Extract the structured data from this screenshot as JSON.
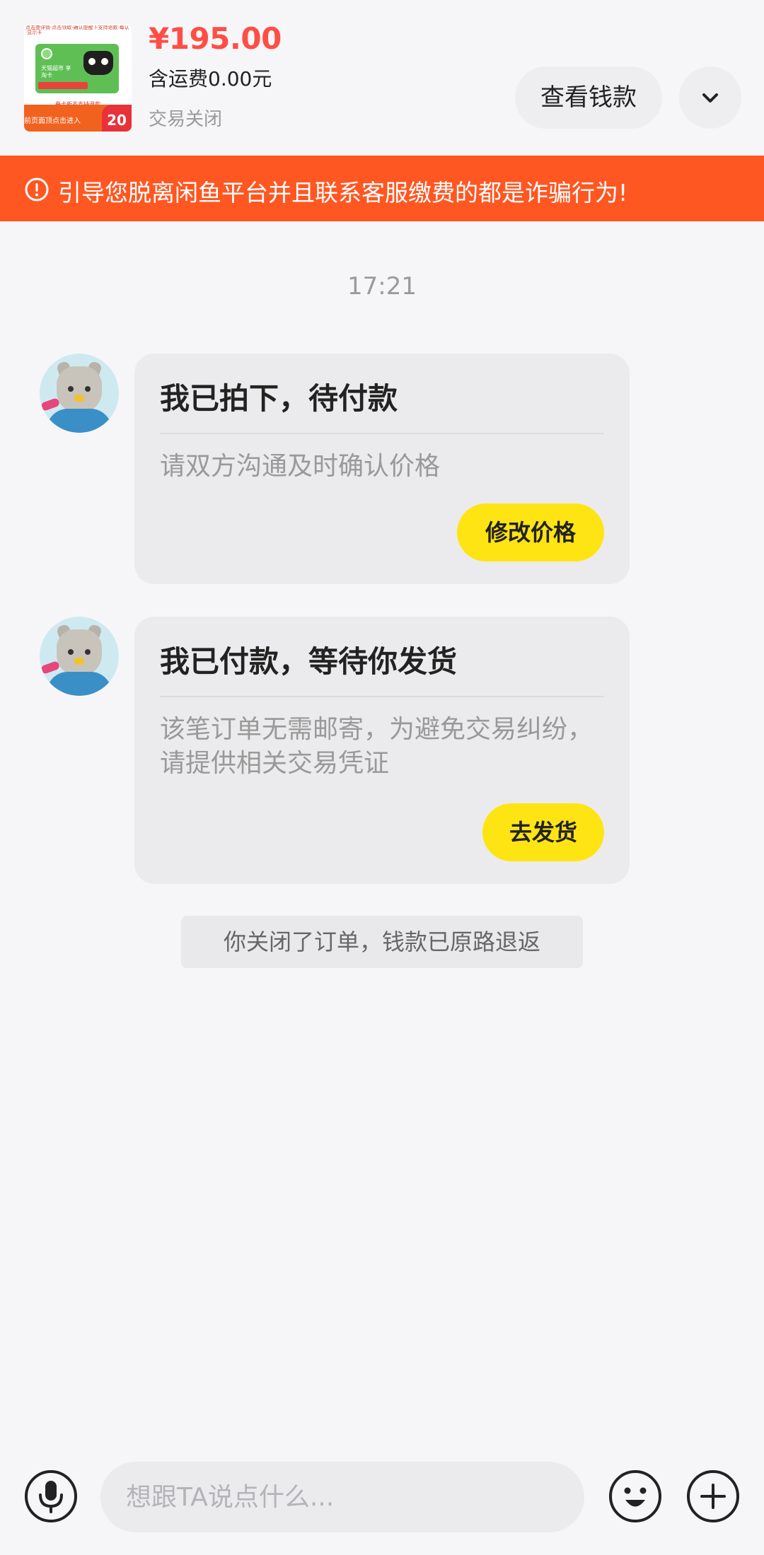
{
  "header": {
    "product_thumb": {
      "tiny_text": "点击查详情·点击领取·确认提醒下支持退款·每认·显示卡",
      "card_lines": "天猫超市 享淘卡",
      "strip_text": "叠卡新不支持退款",
      "enter_text": "前页面顶点击进入",
      "badge": "20"
    },
    "price": "¥195.00",
    "shipping": "含运费0.00元",
    "status": "交易关闭",
    "view_money_label": "查看钱款",
    "expand_icon": "chevron-down-icon"
  },
  "warning": {
    "text": "引导您脱离闲鱼平台并且联系客服缴费的都是诈骗行为!",
    "icon": "alert-circle-icon"
  },
  "chat": {
    "timestamp": "17:21",
    "messages": [
      {
        "title": "我已拍下，待付款",
        "description": "请双方沟通及时确认价格",
        "button_label": "修改价格"
      },
      {
        "title": "我已付款，等待你发货",
        "description": "该笔订单无需邮寄，为避免交易纠纷，请提供相关交易凭证",
        "button_label": "去发货"
      }
    ],
    "system_notice": "你关闭了订单，钱款已原路退返"
  },
  "input_bar": {
    "placeholder": "想跟TA说点什么...",
    "value": "",
    "icons": [
      "microphone-icon",
      "emoji-icon",
      "plus-icon"
    ]
  },
  "colors": {
    "accent_red": "#ff4e45",
    "warning_orange": "#ff5722",
    "button_yellow": "#ffe414"
  }
}
